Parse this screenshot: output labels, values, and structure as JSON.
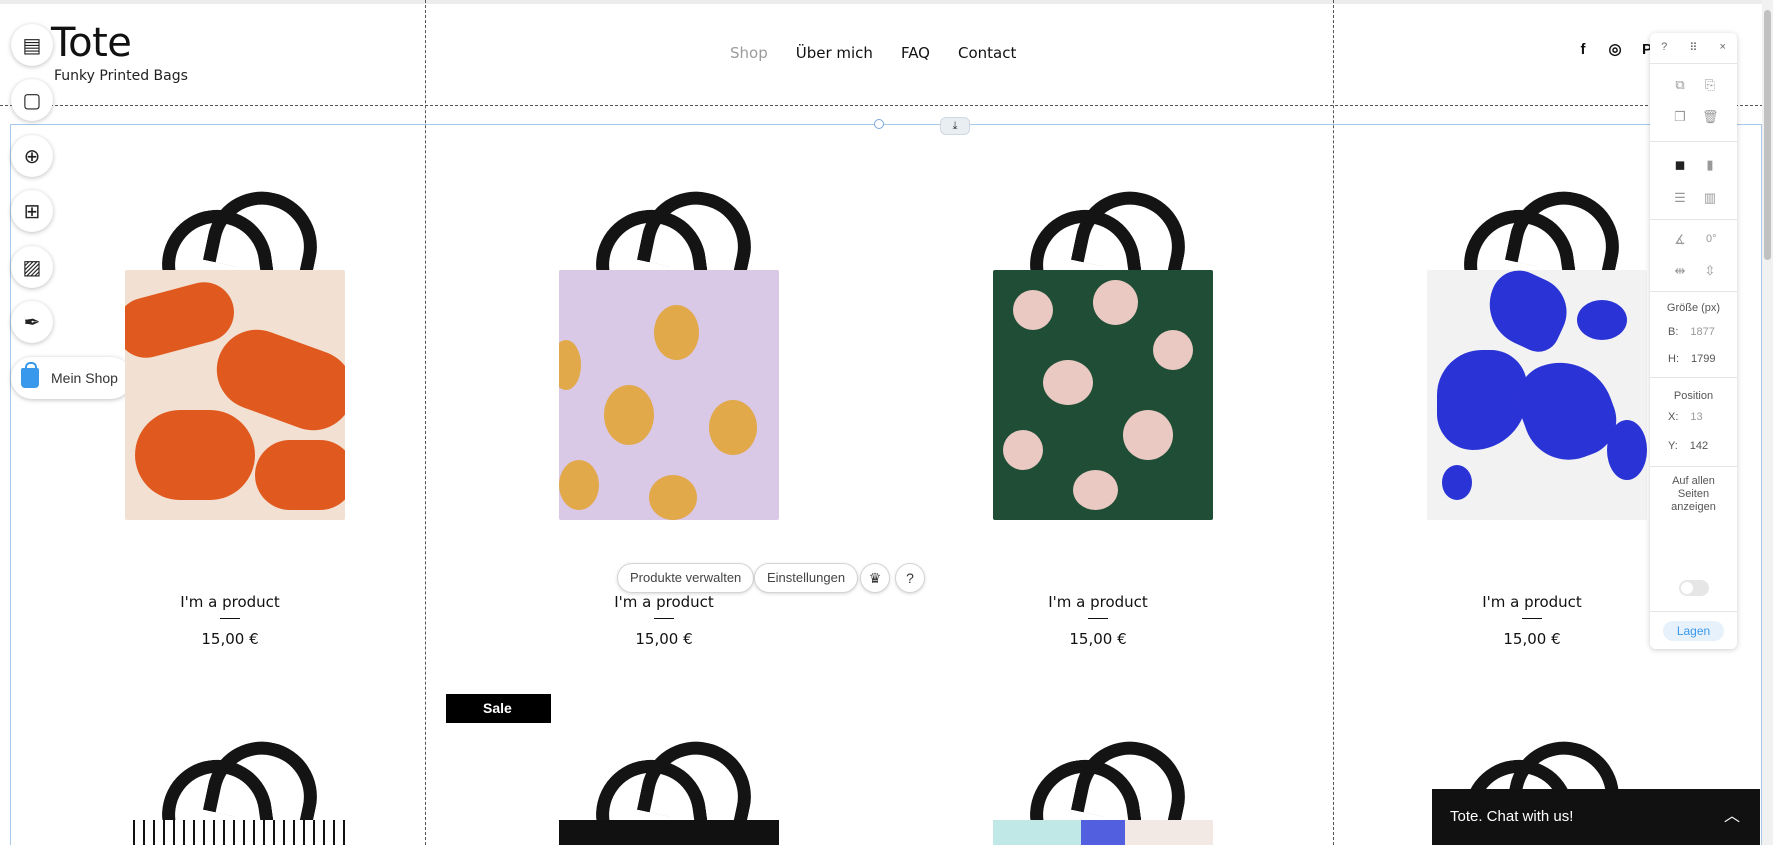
{
  "site": {
    "logo": "Tote",
    "tagline": "Funky Printed Bags"
  },
  "nav": [
    {
      "label": "Shop",
      "active": true
    },
    {
      "label": "Über mich",
      "active": false
    },
    {
      "label": "FAQ",
      "active": false
    },
    {
      "label": "Contact",
      "active": false
    }
  ],
  "social": [
    "f",
    "◎",
    "P"
  ],
  "editor_tools": {
    "shop_label": "Mein Shop"
  },
  "products": [
    {
      "title": "I'm a product",
      "price": "15,00 €",
      "colors": [
        "#e05a20",
        "#f4e4d6"
      ]
    },
    {
      "title": "I'm a product",
      "price": "15,00 €",
      "colors": [
        "#d9c8e6",
        "#e1a94a"
      ]
    },
    {
      "title": "I'm a product",
      "price": "15,00 €",
      "colors": [
        "#1f4d35",
        "#eac9c3"
      ]
    },
    {
      "title": "I'm a product",
      "price": "15,00 €",
      "colors": [
        "#f2f2f2",
        "#2a33d6"
      ]
    }
  ],
  "product_actions": {
    "manage": "Produkte verwalten",
    "settings": "Einstellungen"
  },
  "sale_label": "Sale",
  "panel": {
    "help": "?",
    "close": "×",
    "size_label": "Größe (px)",
    "width_key": "B:",
    "width_val": "1877",
    "height_key": "H:",
    "height_val": "1799",
    "position_label": "Position",
    "x_key": "X:",
    "x_val": "13",
    "y_key": "Y:",
    "y_val": "142",
    "rotation": "0°",
    "show_all_label": "Auf allen Seiten anzeigen",
    "layers_label": "Lagen"
  },
  "chat": {
    "label": "Tote. Chat with us!"
  }
}
